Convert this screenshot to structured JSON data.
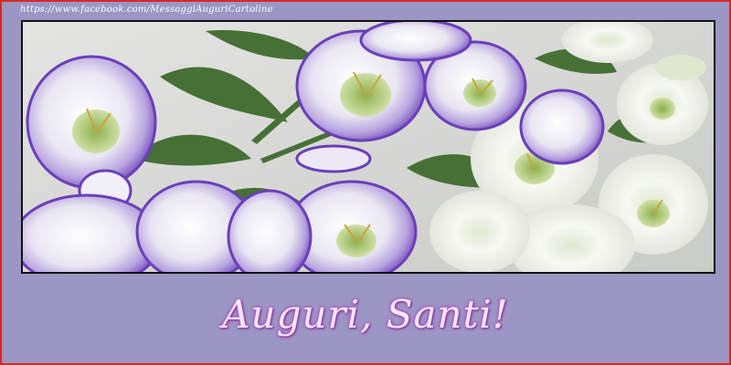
{
  "card": {
    "url_text": "https://www.facebook.com/MessaggiAuguriCartoline",
    "greeting": "Auguri, Santi!",
    "photo_icon": "flower-bouquet-image"
  },
  "colors": {
    "border": "#d42a26",
    "background": "#9b96c4",
    "frame": "#111111",
    "greeting_text": "#f3e8ff",
    "greeting_glow": "#c24fd0",
    "petal_purple": "#7b4fc2",
    "petal_white": "#f4f6f2",
    "leaf_green": "#3f6b2e"
  }
}
